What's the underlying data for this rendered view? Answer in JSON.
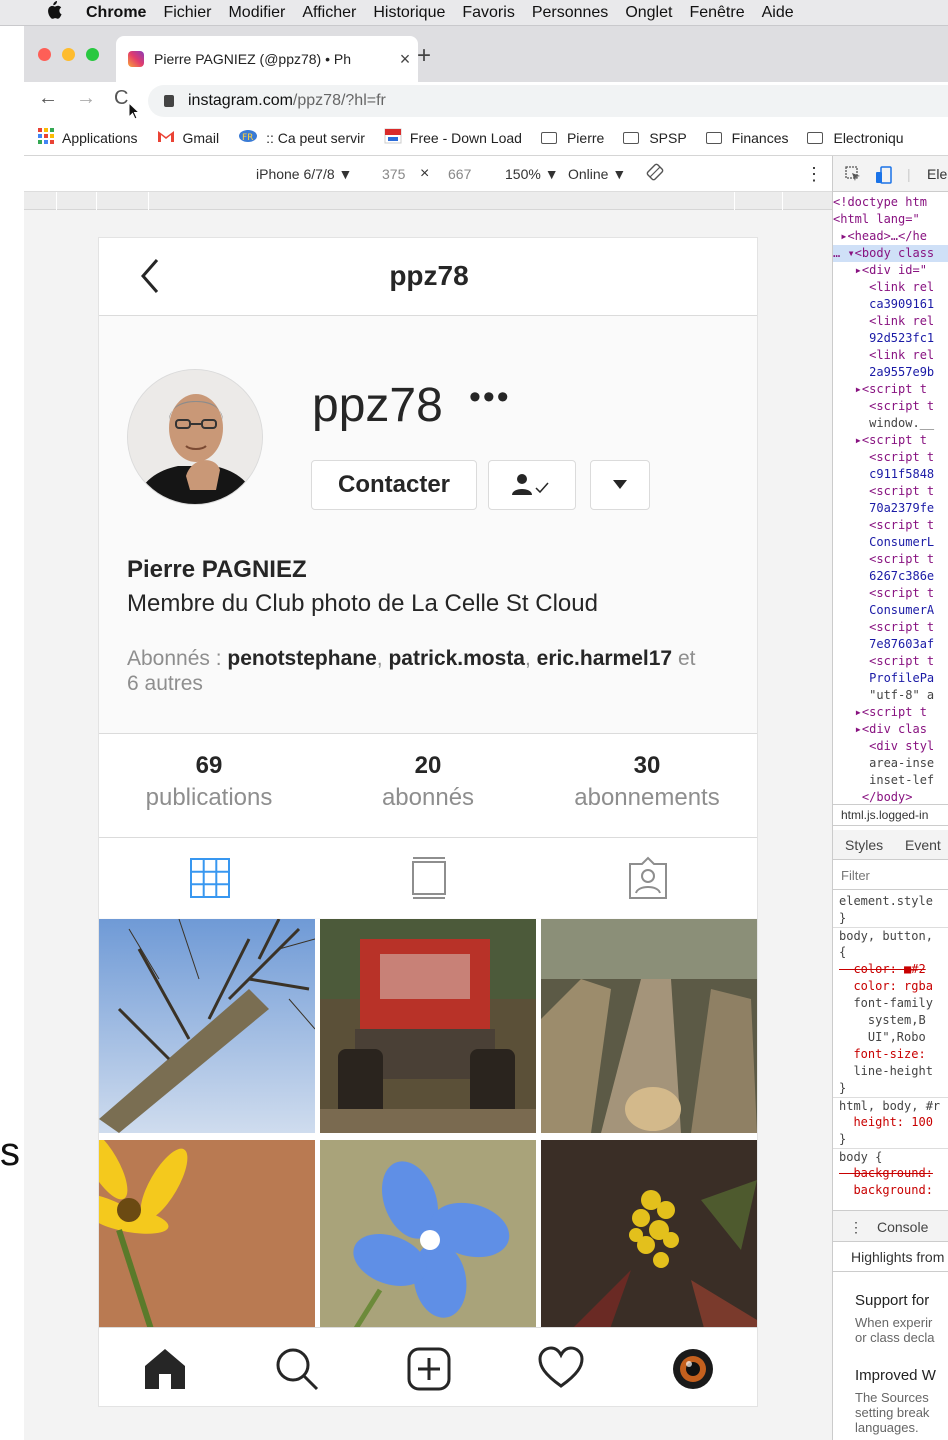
{
  "menubar": {
    "items": [
      "Chrome",
      "Fichier",
      "Modifier",
      "Afficher",
      "Historique",
      "Favoris",
      "Personnes",
      "Onglet",
      "Fenêtre",
      "Aide"
    ]
  },
  "stray_glyph": "s",
  "tab": {
    "title": "Pierre PAGNIEZ (@ppz78) • Ph",
    "close": "×",
    "new_tab": "+"
  },
  "nav": {
    "back": "←",
    "forward": "→",
    "reload": "C"
  },
  "omnibox": {
    "domain": "instagram.com",
    "path": "/ppz78/?hl=fr"
  },
  "bookmarks": [
    {
      "label": "Applications",
      "icon": "apps-grid-icon"
    },
    {
      "label": "Gmail",
      "icon": "gmail-icon"
    },
    {
      "label": ":: Ca peut servir",
      "icon": "web-icon"
    },
    {
      "label": "Free - Down Load",
      "icon": "flag-icon"
    },
    {
      "label": "Pierre",
      "icon": "folder-icon"
    },
    {
      "label": "SPSP",
      "icon": "folder-icon"
    },
    {
      "label": "Finances",
      "icon": "folder-icon"
    },
    {
      "label": "Electroniqu",
      "icon": "folder-icon"
    }
  ],
  "device_toolbar": {
    "device": "iPhone 6/7/8 ▼",
    "width": "375",
    "times": "×",
    "height": "667",
    "zoom": "150% ▼",
    "network": "Online ▼",
    "menu": "⋮"
  },
  "instagram": {
    "header_title": "ppz78",
    "username": "ppz78",
    "more": "•••",
    "contact_button": "Contacter",
    "full_name": "Pierre PAGNIEZ",
    "bio": "Membre du Club photo de La Celle St Cloud",
    "followed_by": {
      "prefix": "Abonnés : ",
      "names": [
        "penotstephane",
        "patrick.mosta",
        "eric.harmel17"
      ],
      "suffix_et": " et",
      "suffix_rest": "6 autres"
    },
    "stats": [
      {
        "num": "69",
        "label": "publications"
      },
      {
        "num": "20",
        "label": "abonnés"
      },
      {
        "num": "30",
        "label": "abonnements"
      }
    ],
    "accent": "#3897f0"
  },
  "devtools": {
    "tab": "Ele",
    "code_lines": [
      "<!doctype htm",
      "<html lang=\"",
      " ▸<head>…</he",
      "… ▾<body class",
      "   ▸<div id=\"",
      "     <link rel",
      "     ca3909161",
      "     <link rel",
      "     92d523fc1",
      "     <link rel",
      "     2a9557e9b",
      "   ▸<script t",
      "     <script t",
      "     window.__",
      "   ▸<script t",
      "     <script t",
      "     c911f5848",
      "     <script t",
      "     70a2379fe",
      "     <script t",
      "     ConsumerL",
      "     <script t",
      "     6267c386e",
      "     <script t",
      "     ConsumerA",
      "     <script t",
      "     7e87603af",
      "     <script t",
      "     ProfilePa",
      "     \"utf-8\" a",
      "   ▸<script t",
      "   ▸<div clas",
      "     <div styl",
      "     area-inse",
      "     inset-lef",
      "    </body>"
    ],
    "breadcrumb": "html.js.logged-in",
    "styles_tab": "Styles",
    "event_tab": "Event",
    "filter": "Filter",
    "style_lines": [
      "element.style",
      "}",
      "body, button,",
      "{",
      "  color: ■#2",
      "  color: rgba",
      "  font-family",
      "    system,B",
      "    UI\",Robo",
      "  font-size:",
      "  line-height",
      "}",
      "html, body, #r",
      "  height: 100",
      "}",
      "body {",
      "  background:",
      "  background:"
    ],
    "console_tab": "Console",
    "highlights": "Highlights from",
    "news": [
      {
        "title": "Support for",
        "text": [
          "When experir",
          "or class decla"
        ]
      },
      {
        "title": "Improved W",
        "text": [
          "The Sources",
          "setting break",
          "languages."
        ]
      }
    ]
  }
}
